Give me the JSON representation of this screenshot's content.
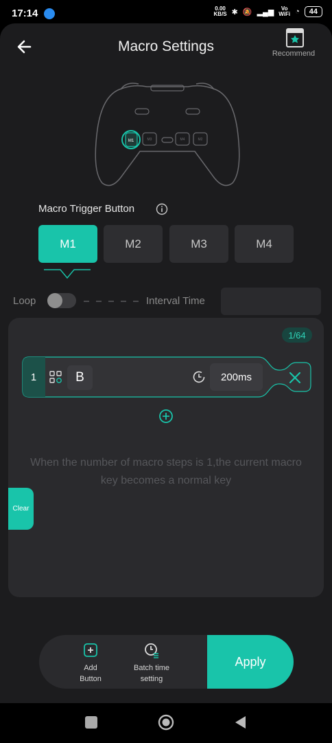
{
  "status_bar": {
    "time": "17:14",
    "speed_value": "0.00",
    "speed_unit": "KB/S",
    "network_line1": "Vo",
    "network_line2": "WiFi",
    "battery": "44"
  },
  "header": {
    "title": "Macro Settings",
    "back_icon": "arrow-left-icon",
    "recommend_label": "Recommend",
    "recommend_icon": "recommend-icon"
  },
  "controller": {
    "back_buttons": [
      "M1",
      "M3",
      "M4",
      "M2"
    ],
    "highlighted": "M1"
  },
  "trigger": {
    "label": "Macro Trigger Button",
    "info_icon": "info-icon",
    "buttons": [
      "M1",
      "M2",
      "M3",
      "M4"
    ],
    "selected": "M1"
  },
  "loop": {
    "label": "Loop",
    "enabled": false,
    "interval_label": "Interval Time",
    "interval_value": ""
  },
  "steps_panel": {
    "counter": "1/64",
    "steps": [
      {
        "index": "1",
        "key": "B",
        "duration": "200ms"
      }
    ],
    "hint": "When the number of macro steps is 1,the current macro key becomes a normal key",
    "clear_label": "Clear"
  },
  "bottom": {
    "add_button_line1": "Add",
    "add_button_line2": "Button",
    "batch_line1": "Batch time",
    "batch_line2": "setting",
    "apply_label": "Apply"
  },
  "colors": {
    "accent": "#19C4AA",
    "background": "#1C1C1E",
    "panel": "#2A2A2D"
  }
}
